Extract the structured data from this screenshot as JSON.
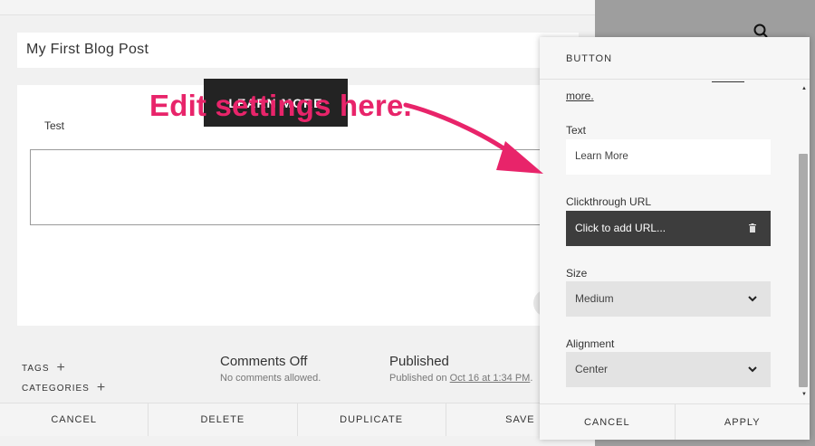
{
  "editor": {
    "title": "My First Blog Post",
    "body_text": "Test",
    "button_label": "LEARN MORE"
  },
  "meta": {
    "tags_label": "TAGS",
    "categories_label": "CATEGORIES",
    "comments_title": "Comments Off",
    "comments_sub": "No comments allowed.",
    "published_title": "Published",
    "published_prefix": "Published on ",
    "published_date": "Oct 16 at 1:34 PM",
    "published_suffix": "."
  },
  "footer": {
    "cancel": "CANCEL",
    "delete": "DELETE",
    "duplicate": "DUPLICATE",
    "save": "SAVE"
  },
  "panel": {
    "title": "BUTTON",
    "more_link": "more.",
    "text_label": "Text",
    "text_value": "Learn More",
    "url_label": "Clickthrough URL",
    "url_placeholder": "Click to add URL...",
    "size_label": "Size",
    "size_value": "Medium",
    "alignment_label": "Alignment",
    "alignment_value": "Center",
    "cancel": "CANCEL",
    "apply": "APPLY"
  },
  "annotation": {
    "text": "Edit settings here.",
    "color": "#e8246a"
  },
  "icons": {
    "search": "search-icon",
    "trash": "trash-icon",
    "chevron": "chevron-down-icon",
    "plus": "plus-icon"
  }
}
